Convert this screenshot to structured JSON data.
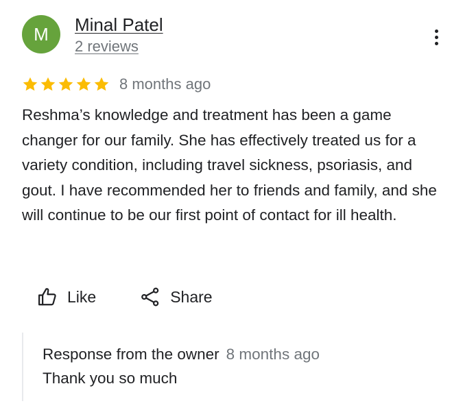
{
  "author": {
    "initial": "M",
    "name": "Minal Patel",
    "review_count": "2 reviews",
    "avatar_color": "#66a33c"
  },
  "more_menu_icon": "vertical-dots-icon",
  "review": {
    "rating": 5,
    "max_rating": 5,
    "star_color": "#fbbc04",
    "time": "8 months ago",
    "text": "Reshma’s knowledge and treatment has been a game changer for our family. She has effectively treated us for a variety condition, including travel sickness, psoriasis, and gout. I have recommended her to friends and family, and she will continue to be our first point of contact for ill health."
  },
  "actions": {
    "like_label": "Like",
    "like_icon": "thumbs-up-icon",
    "share_label": "Share",
    "share_icon": "share-icon"
  },
  "owner_response": {
    "label": "Response from the owner",
    "time": "8 months ago",
    "text": "Thank you so much"
  }
}
